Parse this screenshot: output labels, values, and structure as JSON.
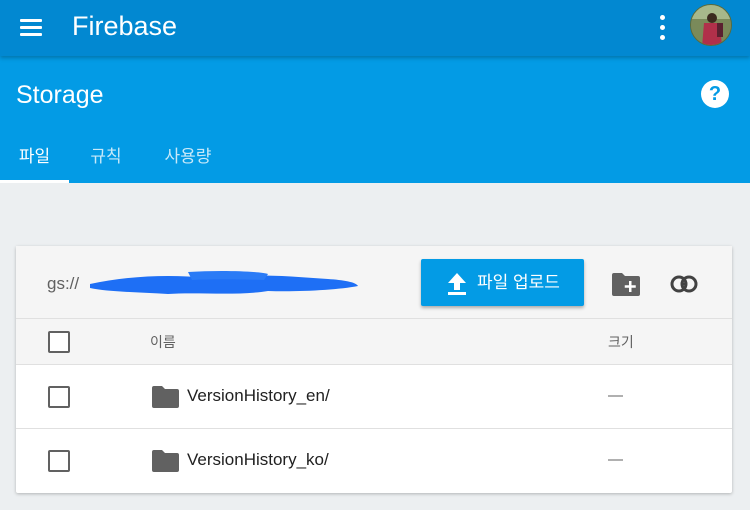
{
  "app": {
    "title": "Firebase"
  },
  "section": {
    "title": "Storage",
    "help_symbol": "?"
  },
  "tabs": [
    {
      "label": "파일",
      "active": true
    },
    {
      "label": "규칙",
      "active": false
    },
    {
      "label": "사용량",
      "active": false
    }
  ],
  "toolbar": {
    "bucket_prefix": "gs://",
    "upload_label": "파일 업로드"
  },
  "table": {
    "headers": {
      "name": "이름",
      "size": "크기"
    },
    "rows": [
      {
        "name": "VersionHistory_en/",
        "size": "—",
        "type": "folder"
      },
      {
        "name": "VersionHistory_ko/",
        "size": "—",
        "type": "folder"
      }
    ]
  },
  "colors": {
    "app_bar": "#0288d1",
    "header": "#039be5",
    "background": "#eceff1",
    "redaction": "#1e6ff5"
  },
  "icons": [
    "menu-icon",
    "more-vert-icon",
    "avatar",
    "help-icon",
    "upload-icon",
    "new-folder-icon",
    "link-icon",
    "folder-icon"
  ]
}
